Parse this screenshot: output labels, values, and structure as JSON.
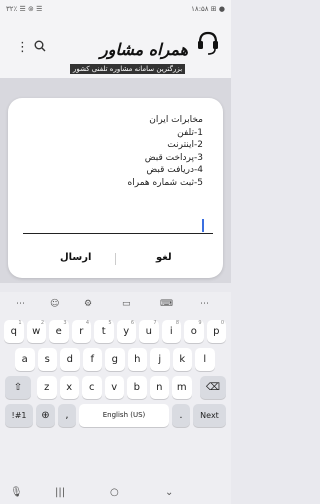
{
  "status": {
    "left": "۳۲٪ ☰ ⊚ ☰",
    "right": "۱۸:۵۸ ⊞ ●"
  },
  "appbar": {
    "menu_icon": "three-dots-icon",
    "search_icon": "search-icon"
  },
  "logo": {
    "title": "همراه مشاور",
    "subtitle": "بزرگترین سامانه مشاوره تلفنی کشور"
  },
  "dialog": {
    "lines": [
      "مخابرات ایران",
      "1-تلفن",
      "2-اینترنت",
      "3-پرداخت قبض",
      "4-دریافت قبض",
      "5-ثبت شماره همراه"
    ],
    "cancel_label": "لغو",
    "send_label": "ارسال"
  },
  "keyboard": {
    "row1": [
      {
        "k": "q",
        "s": "1"
      },
      {
        "k": "w",
        "s": "2"
      },
      {
        "k": "e",
        "s": "3"
      },
      {
        "k": "r",
        "s": "4"
      },
      {
        "k": "t",
        "s": "5"
      },
      {
        "k": "y",
        "s": "6"
      },
      {
        "k": "u",
        "s": "7"
      },
      {
        "k": "i",
        "s": "8"
      },
      {
        "k": "o",
        "s": "9"
      },
      {
        "k": "p",
        "s": "0"
      }
    ],
    "row2": [
      "a",
      "s",
      "d",
      "f",
      "g",
      "h",
      "j",
      "k",
      "l"
    ],
    "row3": [
      "z",
      "x",
      "c",
      "v",
      "b",
      "n",
      "m"
    ],
    "sym_label": "!#1",
    "comma": ",",
    "space_label": "English (US)",
    "period": ".",
    "next_label": "Next"
  },
  "nav": {
    "mic": "🎙",
    "recent": "|||",
    "home": "○",
    "back": "⌄"
  }
}
